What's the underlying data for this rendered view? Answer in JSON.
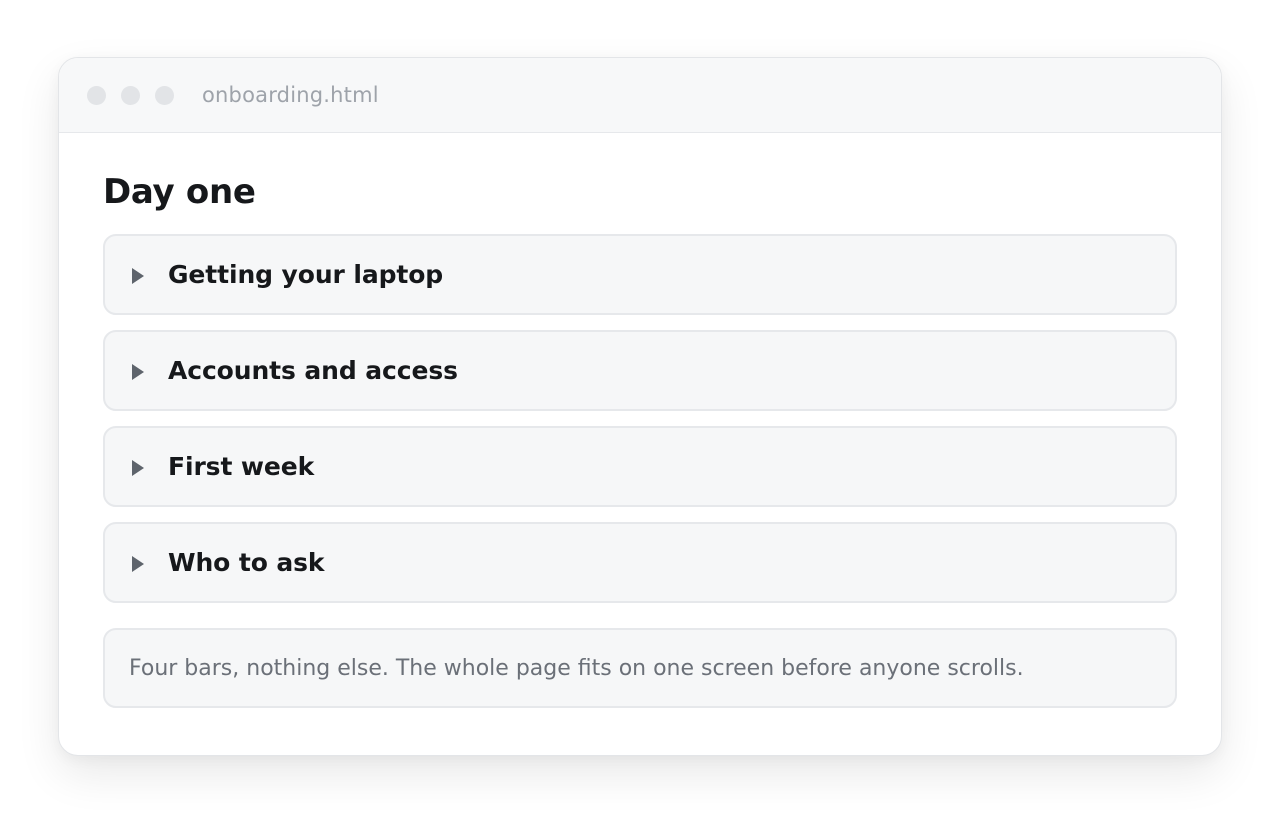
{
  "window": {
    "filename": "onboarding.html"
  },
  "page": {
    "title": "Day one",
    "sections": [
      {
        "label": "Getting your laptop"
      },
      {
        "label": "Accounts and access"
      },
      {
        "label": "First week"
      },
      {
        "label": "Who to ask"
      }
    ],
    "note": "Four bars, nothing else. The whole page fits on one screen before anyone scrolls."
  },
  "colors": {
    "window_dot": "#e2e4e7",
    "bar_background": "#f6f7f8",
    "bar_border": "#e6e8eb",
    "title_text": "#16181b",
    "muted_text": "#6b7078",
    "caret": "#5e646c"
  },
  "icons": {
    "section_toggle": "triangle-right-icon"
  }
}
